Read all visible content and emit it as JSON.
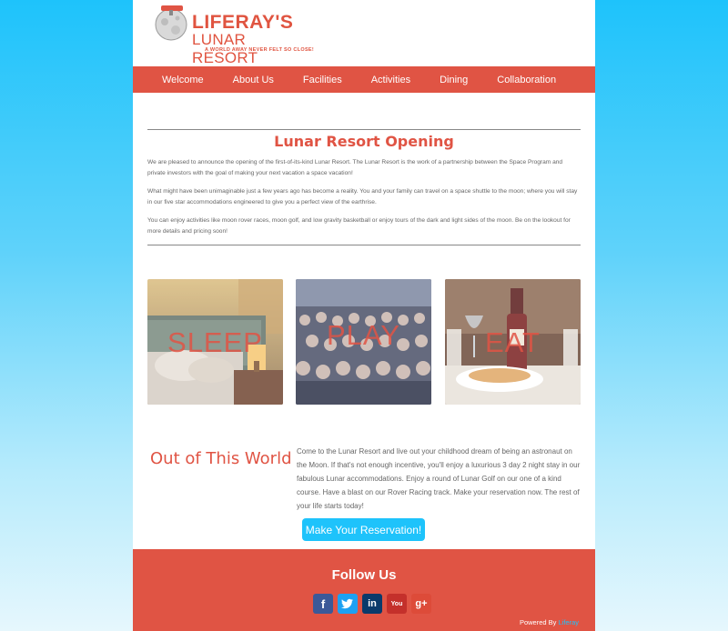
{
  "logo": {
    "title_line1": "LIFERAY'S",
    "title_line2": "LUNAR RESORT",
    "tagline": "A WORLD AWAY NEVER FELT SO CLOSE!"
  },
  "nav": {
    "items": [
      "Welcome",
      "About Us",
      "Facilities",
      "Activities",
      "Dining",
      "Collaboration"
    ]
  },
  "announcement": {
    "title": "Lunar Resort Opening",
    "paragraphs": [
      "We are pleased to announce the opening of the first-of-its-kind Lunar Resort. The Lunar Resort is the work of a partnership between the Space Program and private investors with the goal of making your next vacation a space vacation!",
      "What might have been unimaginable just a few years ago has become a reality. You and your family can travel on a space shuttle to the moon; where you will stay in our five star accommodations engineered to give you a perfect view of the earthrise.",
      "You can enjoy activities like moon rover races, moon golf, and low gravity basketball or enjoy tours of the dark and light sides of the moon. Be on the lookout for more details and pricing soon!"
    ]
  },
  "tiles": [
    {
      "label": "SLEEP"
    },
    {
      "label": "PLAY"
    },
    {
      "label": "EAT"
    }
  ],
  "promo": {
    "title": "Out of This World",
    "text": "Come to the Lunar Resort and live out your childhood dream of being an astronaut on the Moon. If that's not enough incentive, you'll enjoy a luxurious 3 day 2 night stay in our fabulous Lunar accommodations. Enjoy a round of Lunar Golf on our one of a kind course. Have a blast on our Rover Racing track. Make your reservation now. The rest of your life starts today!",
    "button_label": "Make Your Reservation!"
  },
  "footer": {
    "follow_title": "Follow Us",
    "social": [
      {
        "icon": "facebook-icon",
        "glyph": "f",
        "color": "#3b5998"
      },
      {
        "icon": "twitter-icon",
        "glyph": "t",
        "color": "#1da1f2"
      },
      {
        "icon": "linkedin-icon",
        "glyph": "in",
        "color": "#0a3a6b"
      },
      {
        "icon": "youtube-icon",
        "glyph": "You",
        "color": "#c4302b"
      },
      {
        "icon": "googleplus-icon",
        "glyph": "g+",
        "color": "#dd4b39"
      }
    ],
    "powered_by": "Powered By",
    "powered_link": "Liferay"
  },
  "colors": {
    "accent": "#e05444",
    "button": "#1ec3fb",
    "background_top": "#1ec3fb",
    "background_bottom": "#e6f7fd"
  }
}
